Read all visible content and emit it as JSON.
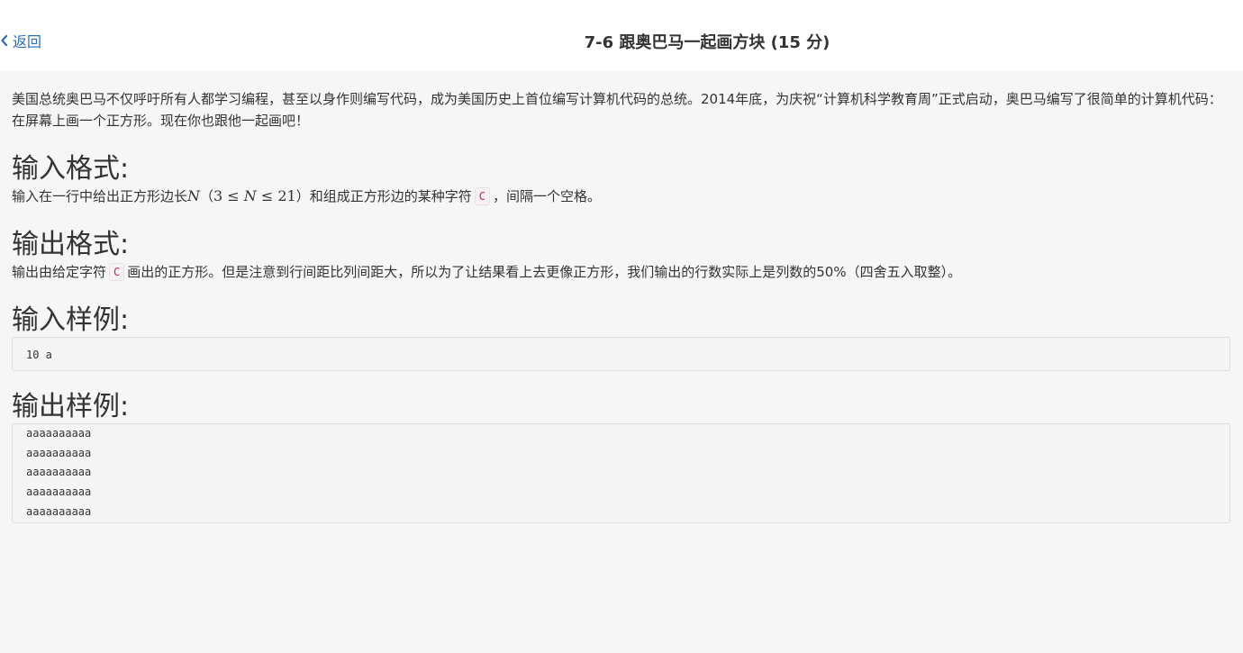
{
  "header": {
    "back_label": "返回",
    "title": "7-6 跟奥巴马一起画方块 (15 分)"
  },
  "problem": {
    "description": "美国总统奥巴马不仅呼吁所有人都学习编程，甚至以身作则编写代码，成为美国历史上首位编写计算机代码的总统。2014年底，为庆祝“计算机科学教育周”正式启动，奥巴马编写了很简单的计算机代码：在屏幕上画一个正方形。现在你也跟他一起画吧！",
    "input_format_heading": "输入格式:",
    "input_format": {
      "before": "输入在一行中给出正方形边长",
      "var_n": "N",
      "range_open": "（",
      "range_low": "3",
      "range_op1": " ≤ ",
      "range_var": "N",
      "range_op2": " ≤ ",
      "range_high": "21",
      "range_close": "）",
      "middle": "和组成正方形边的某种字符",
      "code": "C",
      "after": "，间隔一个空格。"
    },
    "output_format_heading": "输出格式:",
    "output_format": {
      "before": "输出由给定字符",
      "code": "C",
      "after": "画出的正方形。但是注意到行间距比列间距大，所以为了让结果看上去更像正方形，我们输出的行数实际上是列数的50%（四舍五入取整）。"
    },
    "sample_input_heading": "输入样例:",
    "sample_input": "10 a",
    "sample_output_heading": "输出样例:",
    "sample_output": "aaaaaaaaaa\naaaaaaaaaa\naaaaaaaaaa\naaaaaaaaaa\naaaaaaaaaa"
  },
  "icons": {
    "back": "chevron-left-icon"
  },
  "colors": {
    "link": "#2c6db6",
    "code_text": "#c7254e",
    "page_bg": "#f6f6f6"
  }
}
